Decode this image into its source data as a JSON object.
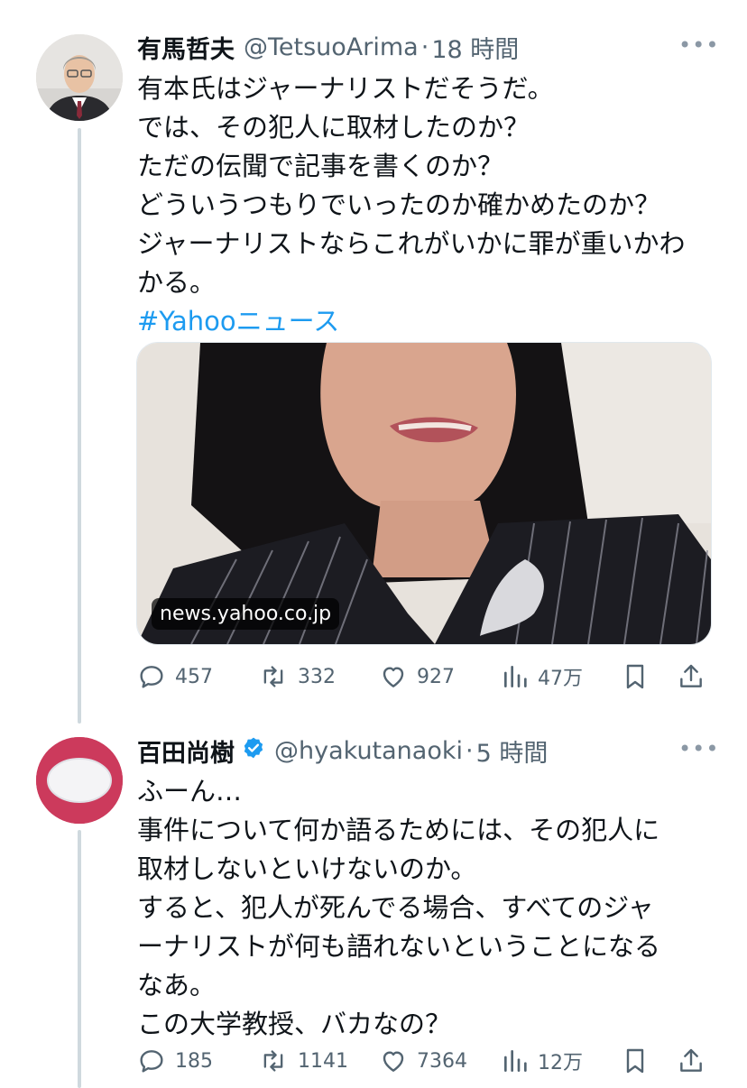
{
  "tweets": [
    {
      "name": "有馬哲夫",
      "handle": "@TetsuoArima",
      "dot": "·",
      "time": "18 時間",
      "more": "•••",
      "lines": [
        "有本氏はジャーナリストだそうだ。",
        "では、その犯人に取材したのか？",
        "ただの伝聞で記事を書くのか？",
        "どういうつもりでいったのか確かめたのか？",
        "ジャーナリストならこれがいかに罪が重いかわ",
        "かる。"
      ],
      "hashtag": "#Yahooニュース",
      "card_domain": "news.yahoo.co.jp",
      "replies": "457",
      "retweets": "332",
      "likes": "927",
      "views": "47万"
    },
    {
      "name": "百田尚樹",
      "verified": true,
      "handle": "@hyakutanaoki",
      "dot": "·",
      "time": "5 時間",
      "more": "•••",
      "lines": [
        "ふーん…",
        "事件について何か語るためには、その犯人に",
        "取材しないといけないのか。",
        "すると、犯人が死んでる場合、すべてのジャ",
        "ーナリストが何も語れないということになる",
        "なあ。",
        "この大学教授、バカなの？"
      ],
      "replies": "185",
      "retweets": "1141",
      "likes": "7364",
      "views": "12万"
    }
  ],
  "colors": {
    "accent": "#1d9bf0",
    "muted": "#536471",
    "avatar2_bg": "#cc3a5c"
  }
}
